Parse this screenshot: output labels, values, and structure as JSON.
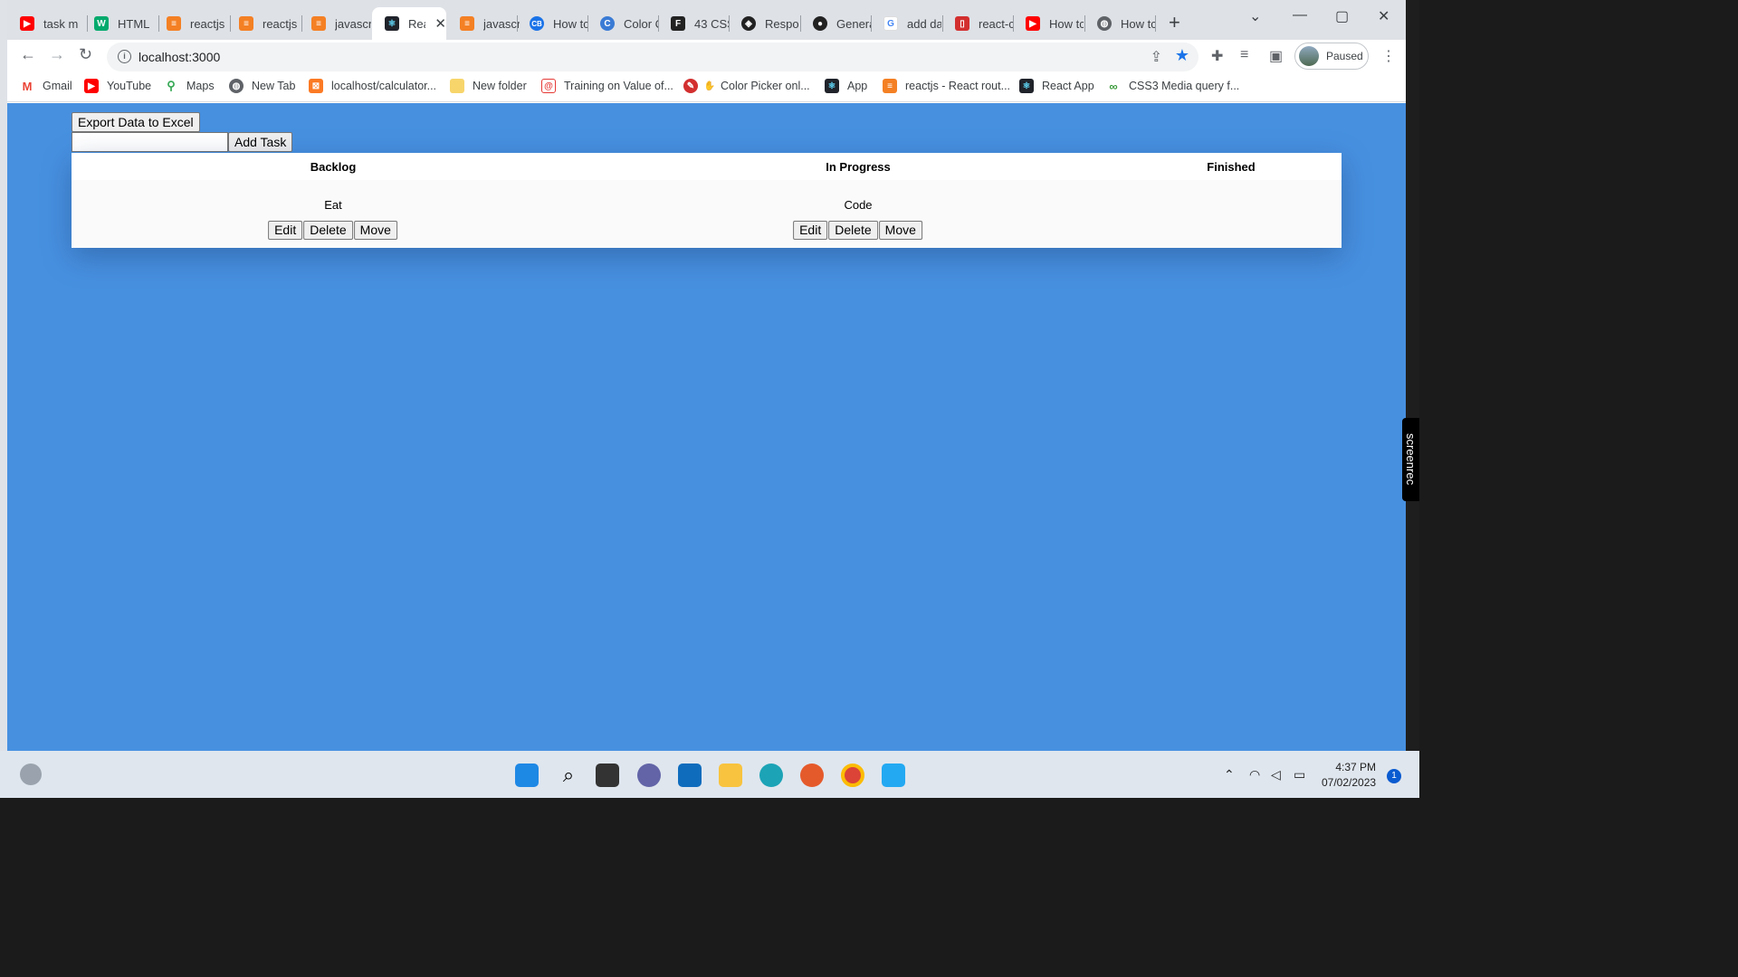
{
  "browser": {
    "tabs": [
      {
        "label": "task m",
        "icon": "youtube-icon",
        "color": "#ff0000"
      },
      {
        "label": "HTML",
        "icon": "w3schools-icon",
        "color": "#04aa6d"
      },
      {
        "label": "reactjs",
        "icon": "stackoverflow-icon",
        "color": "#f48024"
      },
      {
        "label": "reactjs",
        "icon": "stackoverflow-icon",
        "color": "#f48024"
      },
      {
        "label": "javascr",
        "icon": "stackoverflow-icon",
        "color": "#f48024"
      },
      {
        "label": "Rea",
        "icon": "react-icon",
        "color": "#20232a"
      },
      {
        "label": "javascr",
        "icon": "stackoverflow-icon",
        "color": "#f48024"
      },
      {
        "label": "How tc",
        "icon": "codebeautify-icon",
        "color": "#1a73e8"
      },
      {
        "label": "Color C",
        "icon": "color-icon",
        "color": "#3a7bd5"
      },
      {
        "label": "43 CSS",
        "icon": "f-icon",
        "color": "#222222"
      },
      {
        "label": "Respor",
        "icon": "codepen-icon",
        "color": "#222222"
      },
      {
        "label": "Genera",
        "icon": "github-icon",
        "color": "#222222"
      },
      {
        "label": "add da",
        "icon": "google-icon",
        "color": "#4285f4"
      },
      {
        "label": "react-c",
        "icon": "red-square-icon",
        "color": "#d32f2f"
      },
      {
        "label": "How tc",
        "icon": "youtube-icon",
        "color": "#ff0000"
      },
      {
        "label": "How tc",
        "icon": "globe-icon",
        "color": "#5f6368"
      }
    ],
    "url": "localhost:3000",
    "profile_status": "Paused",
    "bookmarks": [
      {
        "label": "Gmail",
        "icon": "gmail-icon",
        "color": "#ea4335"
      },
      {
        "label": "YouTube",
        "icon": "youtube-icon",
        "color": "#ff0000"
      },
      {
        "label": "Maps",
        "icon": "maps-icon",
        "color": "#34a853"
      },
      {
        "label": "New Tab",
        "icon": "globe-icon",
        "color": "#5f6368"
      },
      {
        "label": "localhost/calculator...",
        "icon": "xampp-icon",
        "color": "#fb7a24"
      },
      {
        "label": "New folder",
        "icon": "folder-icon",
        "color": "#f7d56b"
      },
      {
        "label": "Training on Value of...",
        "icon": "spiral-icon",
        "color": "#e53935"
      },
      {
        "label": "Color Picker onl...",
        "icon": "picker-icon",
        "color": "#d32f2f"
      },
      {
        "label": "App",
        "icon": "react-icon",
        "color": "#20232a"
      },
      {
        "label": "reactjs - React rout...",
        "icon": "stackoverflow-icon",
        "color": "#f48024"
      },
      {
        "label": "React App",
        "icon": "react-icon",
        "color": "#20232a"
      },
      {
        "label": "CSS3 Media query f...",
        "icon": "infinity-icon",
        "color": "#3b9b3b"
      }
    ]
  },
  "app": {
    "export_label": "Export Data to Excel",
    "add_task_label": "Add Task",
    "task_input_value": "",
    "columns": [
      {
        "title": "Backlog",
        "tasks": [
          {
            "name": "Eat"
          }
        ]
      },
      {
        "title": "In Progress",
        "tasks": [
          {
            "name": "Code"
          }
        ]
      },
      {
        "title": "Finished",
        "tasks": []
      }
    ],
    "action_labels": {
      "edit": "Edit",
      "delete": "Delete",
      "move": "Move"
    }
  },
  "overlay": {
    "screenrec_label": "screenrec"
  },
  "taskbar": {
    "time": "4:37 PM",
    "date": "07/02/2023",
    "notifications": "1"
  },
  "colors": {
    "page_background": "#4790e0",
    "accent": "#1a73e8"
  }
}
